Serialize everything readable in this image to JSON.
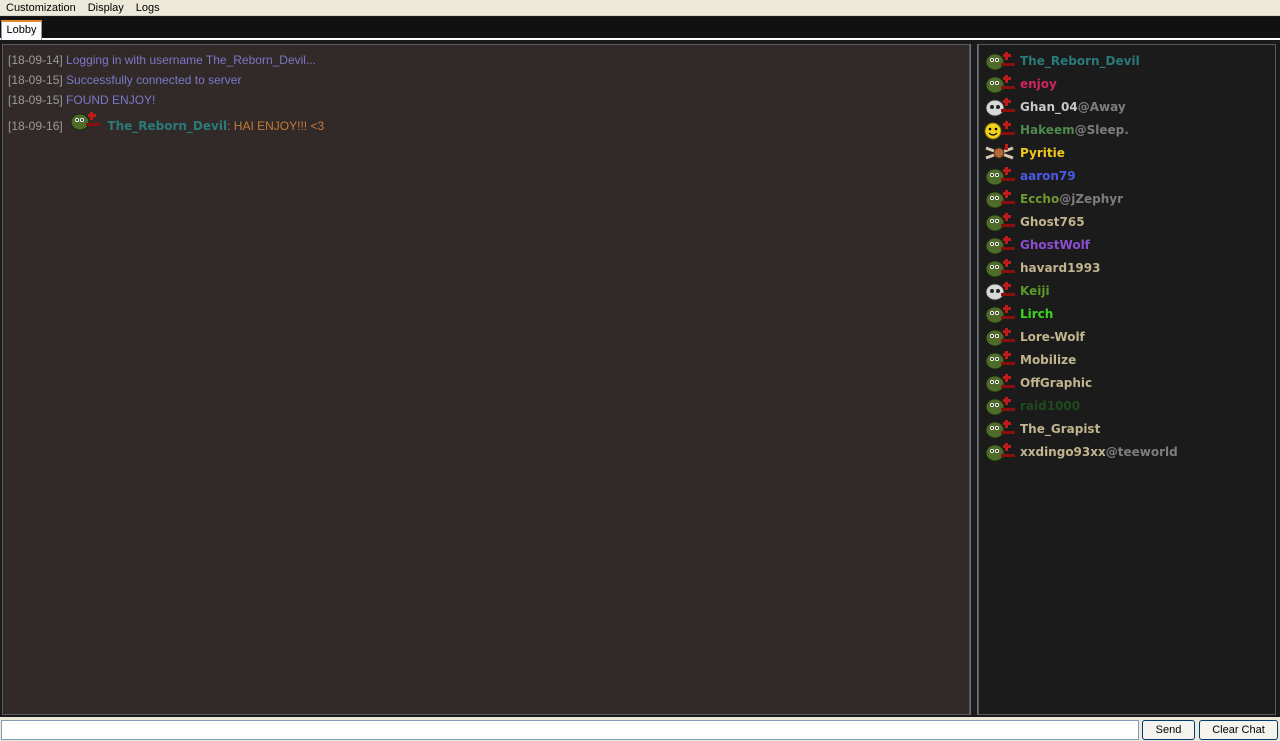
{
  "menu": {
    "items": [
      "Customization",
      "Display",
      "Logs"
    ]
  },
  "tabs": [
    {
      "label": "Lobby"
    }
  ],
  "chat": {
    "lines": [
      {
        "timestamp": "[18-09-14]",
        "text": "Logging in with username The_Reborn_Devil..."
      },
      {
        "timestamp": "[18-09-15]",
        "text": "Successfully connected to server"
      },
      {
        "timestamp": "[18-09-15]",
        "text": "FOUND ENJOY!"
      }
    ],
    "user_message": {
      "timestamp": "[18-09-16]",
      "username": "The_Reborn_Devil",
      "separator": ":",
      "text": "HAI ENJOY!!! <3",
      "username_color": "#2a7a7a",
      "avatar": "tee-green-avatar-icon"
    }
  },
  "users": [
    {
      "name": "The_Reborn_Devil",
      "status": "",
      "color": "#2a7a7a",
      "avatar": "tee-green"
    },
    {
      "name": "enjoy",
      "status": "",
      "color": "#d0245c",
      "avatar": "tee-green"
    },
    {
      "name": "Ghan_04",
      "status": "@Away",
      "color": "#c8c8c8",
      "avatar": "tee-skull"
    },
    {
      "name": "Hakeem",
      "status": "@Sleep.",
      "color": "#4e8a4e",
      "avatar": "tee-yellow"
    },
    {
      "name": "Pyritie",
      "status": "",
      "color": "#f0c81e",
      "avatar": "tee-star"
    },
    {
      "name": "aaron79",
      "status": "",
      "color": "#4a5ae6",
      "avatar": "tee-green"
    },
    {
      "name": "Eccho",
      "status": "@jZephyr",
      "color": "#6c9a2e",
      "avatar": "tee-green"
    },
    {
      "name": "Ghost765",
      "status": "",
      "color": "#c2b48e",
      "avatar": "tee-green"
    },
    {
      "name": "GhostWolf",
      "status": "",
      "color": "#8a4ed0",
      "avatar": "tee-green"
    },
    {
      "name": "havard1993",
      "status": "",
      "color": "#c2b48e",
      "avatar": "tee-green"
    },
    {
      "name": "Keiji",
      "status": "",
      "color": "#5a9a2a",
      "avatar": "tee-skull"
    },
    {
      "name": "Lirch",
      "status": "",
      "color": "#3ad61e",
      "avatar": "tee-green"
    },
    {
      "name": "Lore-Wolf",
      "status": "",
      "color": "#c2b48e",
      "avatar": "tee-green"
    },
    {
      "name": "Mobilize",
      "status": "",
      "color": "#c2b48e",
      "avatar": "tee-green"
    },
    {
      "name": "OffGraphic",
      "status": "",
      "color": "#c2b48e",
      "avatar": "tee-green"
    },
    {
      "name": "raid1000",
      "status": "",
      "color": "#1e4a1e",
      "avatar": "tee-green"
    },
    {
      "name": "The_Grapist",
      "status": "",
      "color": "#c2b48e",
      "avatar": "tee-green"
    },
    {
      "name": "xxdingo93xx",
      "status": "@teeworld",
      "color": "#c2b48e",
      "avatar": "tee-green"
    }
  ],
  "input": {
    "value": "",
    "placeholder": ""
  },
  "buttons": {
    "send": "Send",
    "clear": "Clear Chat"
  },
  "colors": {
    "chat_bg": "#322a28",
    "userlist_bg": "#1b1b1b",
    "system_text": "#7b78c8",
    "user_text": "#c77a3a",
    "timestamp": "#9a9a9a"
  }
}
